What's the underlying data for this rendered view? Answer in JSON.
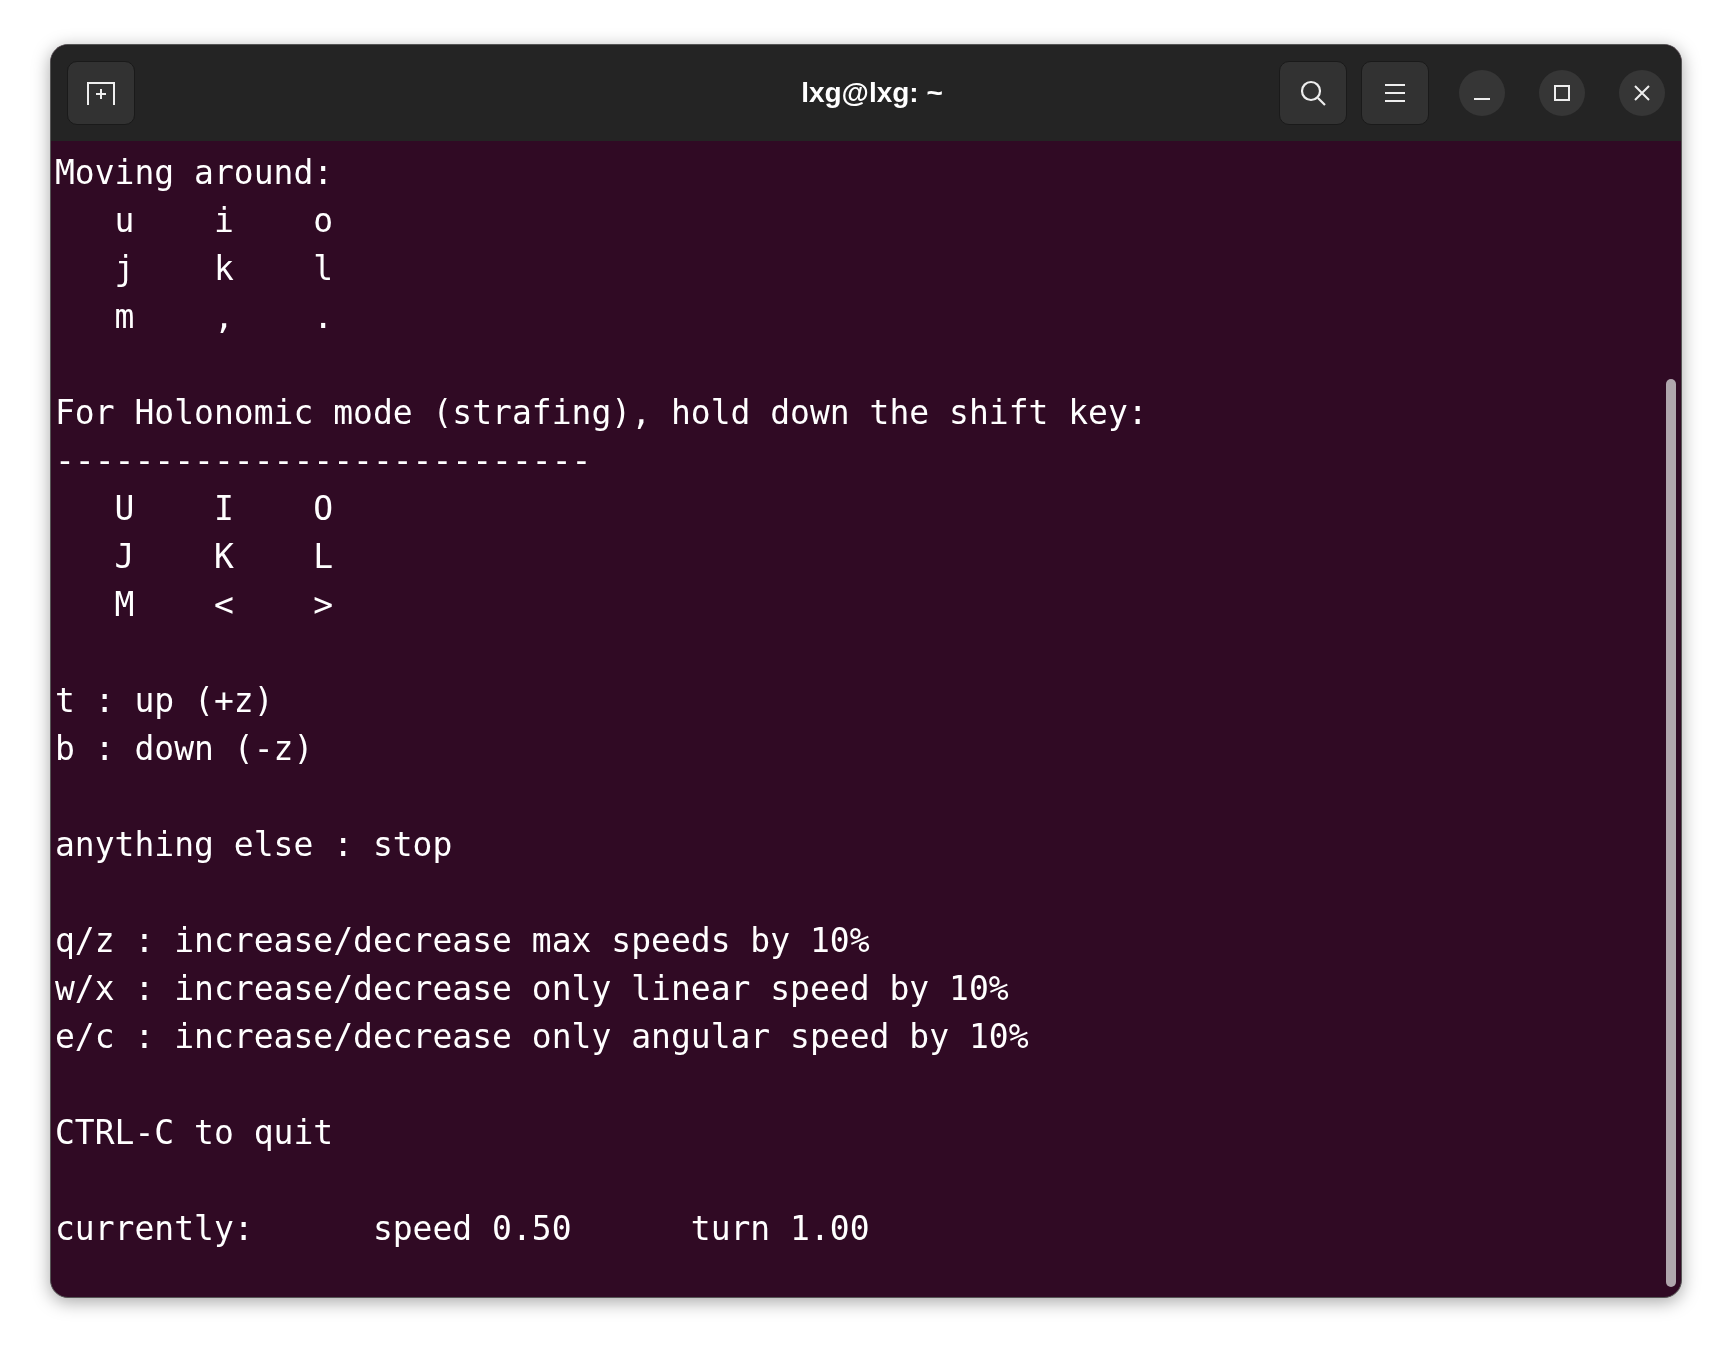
{
  "window": {
    "title": "lxg@lxg: ~"
  },
  "terminal": {
    "blocks": [
      [
        "Moving around:",
        "   u    i    o",
        "   j    k    l",
        "   m    ,    ."
      ],
      [
        "For Holonomic mode (strafing), hold down the shift key:",
        "---------------------------",
        "   U    I    O",
        "   J    K    L",
        "   M    <    >"
      ],
      [
        "t : up (+z)",
        "b : down (-z)"
      ],
      [
        "anything else : stop"
      ],
      [
        "q/z : increase/decrease max speeds by 10%",
        "w/x : increase/decrease only linear speed by 10%",
        "e/c : increase/decrease only angular speed by 10%"
      ],
      [
        "CTRL-C to quit"
      ],
      [
        "currently:      speed 0.50      turn 1.00"
      ]
    ]
  }
}
